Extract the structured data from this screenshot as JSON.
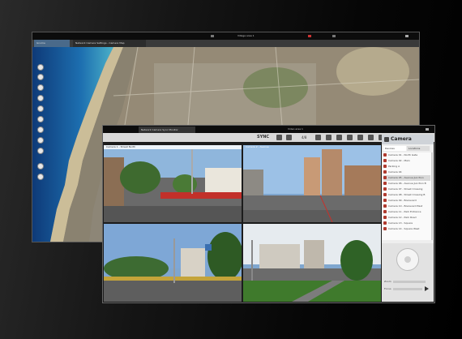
{
  "map_window": {
    "tabs": [
      {
        "label": "Gnome"
      },
      {
        "label": "Network Camera Settings  -  Camera Map"
      }
    ],
    "titlebar_info": "Village area 1"
  },
  "camera_window": {
    "titlebar_tab": "Network Camera Sync Monitor",
    "titlebar_info": "Video area 1",
    "toolbar": {
      "sync_label": "SYNC",
      "speed_label": "4/8"
    },
    "tiles": [
      {
        "label": "Camera 1 - Street North"
      },
      {
        "label": "Camera 2 - Avenue"
      },
      {
        "label": "Camera 3 - Junction"
      },
      {
        "label": "Camera 4 - Park Road"
      }
    ],
    "panel": {
      "title": "Camera",
      "tabs": [
        "Devices",
        "Locations"
      ],
      "items": [
        {
          "label": "Camera 01 - North Gate"
        },
        {
          "label": "Camera 02 - Main"
        },
        {
          "label": "Parking A"
        },
        {
          "label": "Camera 04"
        },
        {
          "label": "Camera 05 - Avenue Junction"
        },
        {
          "label": "Camera 06 - Avenue Junction B"
        },
        {
          "label": "Camera 07 - Street Crossing"
        },
        {
          "label": "Camera 08 - Street Crossing B"
        },
        {
          "label": "Camera 09 - Boulevard"
        },
        {
          "label": "Camera 10 - Boulevard East"
        },
        {
          "label": "Camera 11 - Park Entrance"
        },
        {
          "label": "Camera 12 - Park Road"
        },
        {
          "label": "Camera 13 - Square"
        },
        {
          "label": "Camera 14 - Square West"
        }
      ],
      "ptz": {
        "zoom_label": "Zoom",
        "focus_label": "Focus"
      }
    }
  }
}
